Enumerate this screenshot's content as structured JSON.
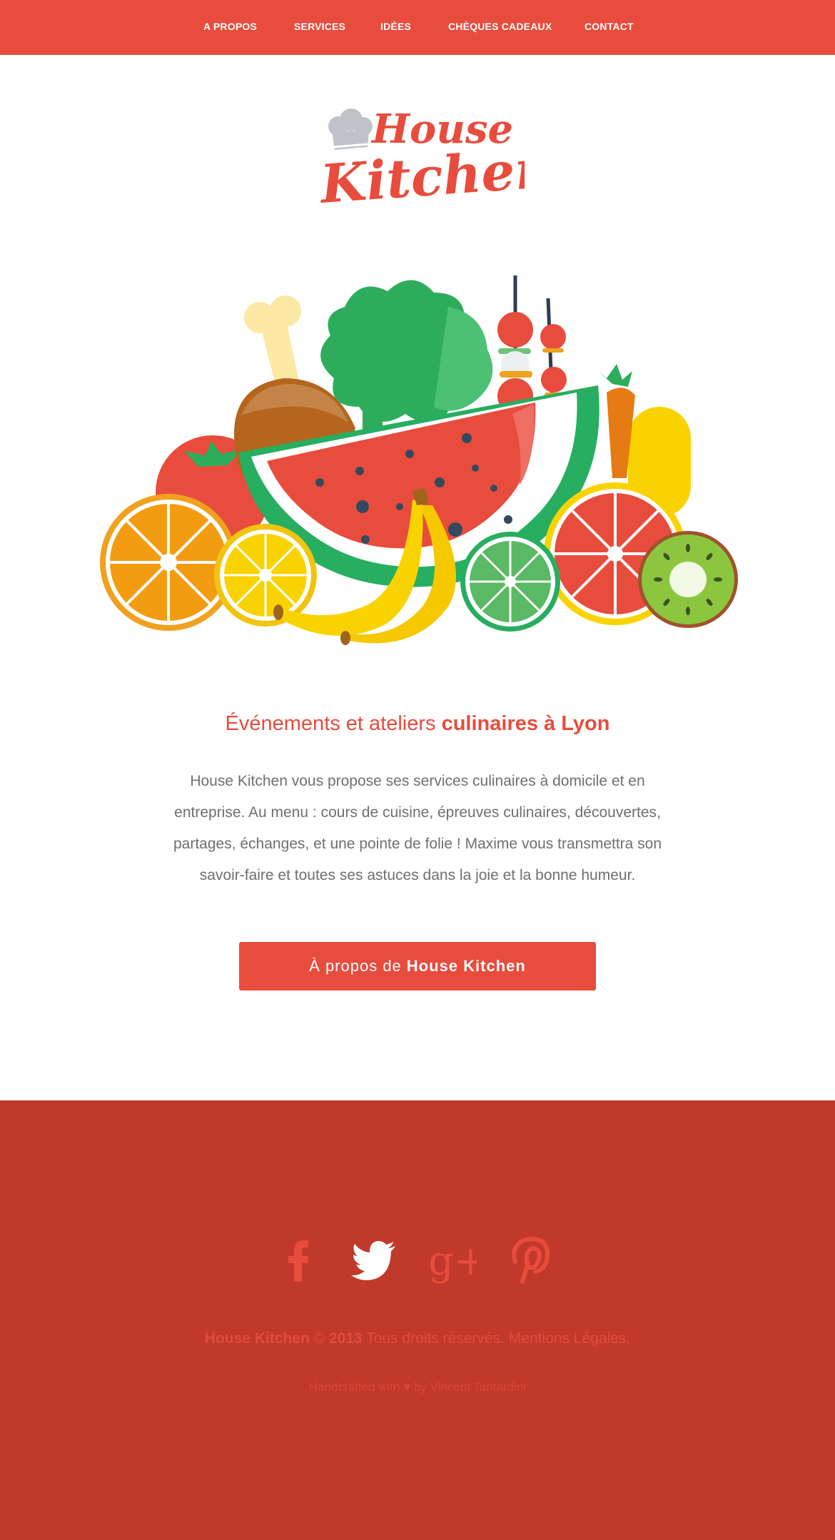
{
  "nav": {
    "items": [
      {
        "label": "A PROPOS"
      },
      {
        "label": "SERVICES"
      },
      {
        "label": "IDÉES"
      },
      {
        "label": "CHÈQUES CADEAUX"
      },
      {
        "label": "CONTACT"
      }
    ]
  },
  "logo": {
    "line1": "House",
    "line2": "Kitchen",
    "icon": "chef-hat-icon"
  },
  "hero": {
    "illustration": "fruits-and-vegetables-illustration"
  },
  "headline": {
    "light": "Événements et ateliers",
    "strong": "culinaires à Lyon"
  },
  "intro": {
    "text": "House Kitchen vous propose ses services culinaires à domicile et en entreprise. Au menu : cours de cuisine, épreuves culinaires, découvertes, partages, échanges, et une pointe de folie ! Maxime vous transmettra son savoir-faire et toutes ses astuces dans la joie et la bonne humeur."
  },
  "cta": {
    "prefix": "À propos de",
    "strong": "House Kitchen"
  },
  "footer": {
    "social": [
      {
        "name": "facebook-icon"
      },
      {
        "name": "twitter-icon"
      },
      {
        "name": "google-plus-icon"
      },
      {
        "name": "pinterest-icon"
      }
    ],
    "copyright": {
      "brand": "House Kitchen",
      "symbol": "©",
      "year": "2013",
      "rights": "Tous droits réservés.",
      "legal": "Mentions Légales."
    },
    "credit": {
      "prefix": "Handcrafted with",
      "heart": "♥",
      "suffix": "by Vincent Tantardini"
    }
  },
  "colors": {
    "brand_red": "#e84c3d",
    "footer_red": "#c0392b",
    "body_text": "#6f6f6f",
    "white": "#ffffff"
  }
}
